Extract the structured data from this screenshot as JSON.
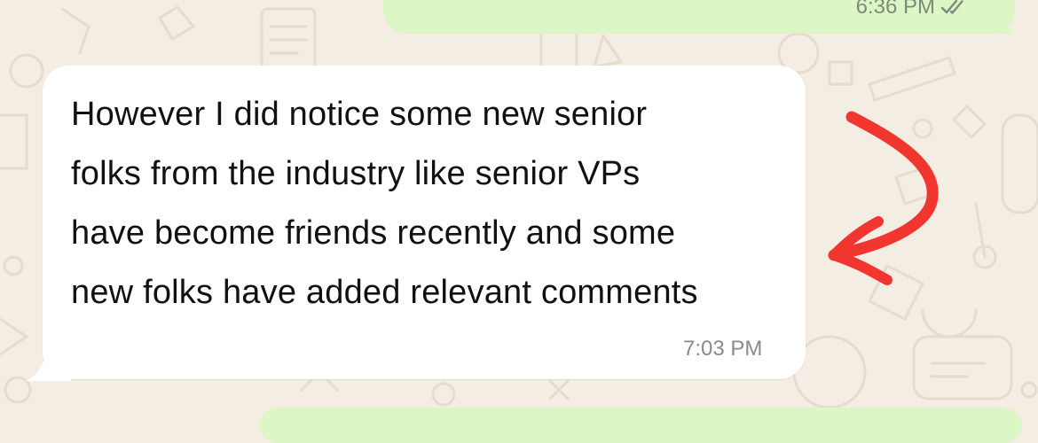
{
  "outgoing_message": {
    "time": "6:36 PM",
    "status_icon": "double-check-icon"
  },
  "incoming_message": {
    "lines": [
      "However I did notice some new senior",
      "folks from the industry like senior VPs",
      "have become friends recently and some",
      "new folks have added relevant comments"
    ],
    "time": "7:03 PM"
  },
  "annotation": {
    "icon": "hand-drawn-arrow-icon",
    "color": "#f0362f"
  },
  "colors": {
    "background": "#f3ede4",
    "outgoing_bubble": "#dcf7c5",
    "incoming_bubble": "#ffffff"
  }
}
